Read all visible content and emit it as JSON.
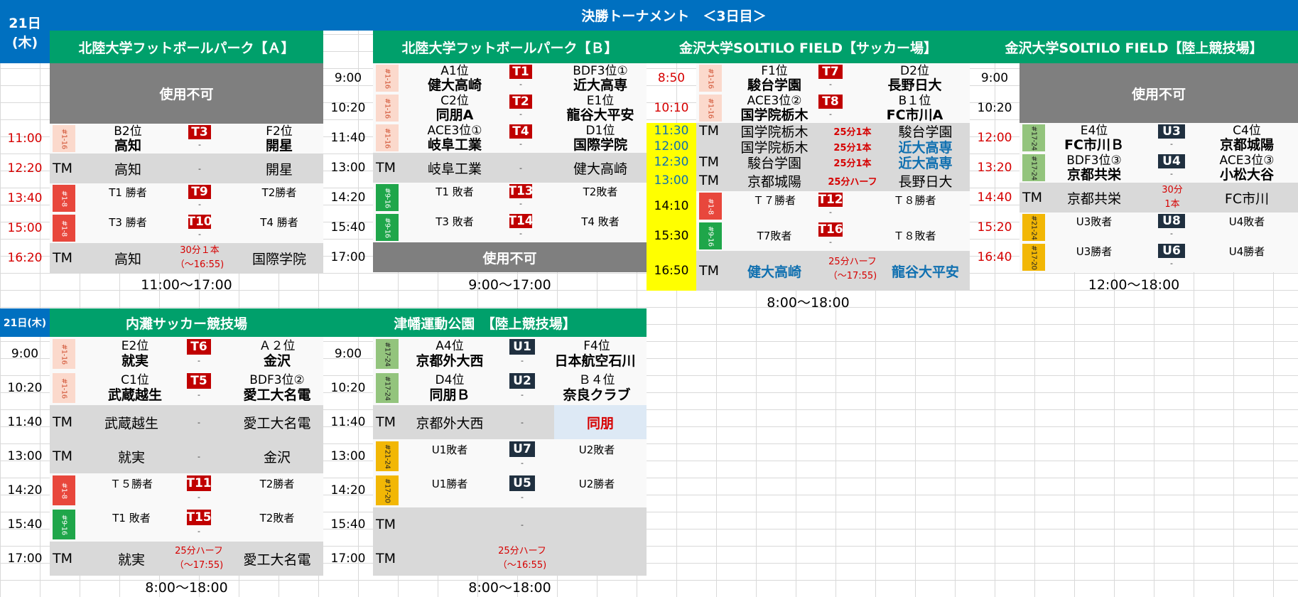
{
  "title": "決勝トーナメント　＜3日目＞",
  "day": "21日",
  "weekday": "(木)",
  "day2": "21日(木)",
  "venues": {
    "a": "北陸大学フットボールパーク【Ａ】",
    "b": "北陸大学フットボールパーク【Ｂ】",
    "c": "金沢大学SOLTILO FIELD【サッカー場】",
    "d": "金沢大学SOLTILO FIELD【陸上競技場】",
    "e": "内灘サッカー競技場",
    "f": "津幡運動公園　【陸上競技場】"
  },
  "unavailable": "使用不可",
  "tm": "TM",
  "dash": "-",
  "hours": {
    "a": "11:00～17:00",
    "b": "9:00～17:00",
    "c": "8:00～18:00",
    "d": "12:00～18:00",
    "e": "8:00～18:00",
    "f": "8:00～18:00"
  },
  "a": {
    "t1": "11:00",
    "m1": {
      "tag": "#1-16",
      "h": "B2位",
      "hs": "高知",
      "b": "T3",
      "a": "F2位",
      "as": "開星"
    },
    "t2": "12:20",
    "r2": {
      "h": "高知",
      "a": "開星"
    },
    "t3": "13:40",
    "m3": {
      "tag": "#1-8",
      "h": "T1 勝者",
      "b": "T9",
      "a": "T2勝者"
    },
    "t4": "15:00",
    "m4": {
      "tag": "#1-8",
      "h": "T3 勝者",
      "b": "T10",
      "a": "T4 勝者"
    },
    "t5": "16:20",
    "r5": {
      "h": "高知",
      "n1": "30分１本",
      "n2": "（～16:55)",
      "a": "国際学院"
    }
  },
  "b": {
    "t1": "9:00",
    "m1": {
      "tag": "#1-16",
      "h": "A1位",
      "hs": "健大高崎",
      "b": "T1",
      "a": "BDF3位①",
      "as": "近大高専"
    },
    "t2": "10:20",
    "m2": {
      "tag": "#1-16",
      "h": "C2位",
      "hs": "同朋A",
      "b": "T2",
      "a": "E1位",
      "as": "龍谷大平安"
    },
    "t3": "11:40",
    "m3": {
      "tag": "#1-16",
      "h": "ACE3位①",
      "hs": "岐阜工業",
      "b": "T4",
      "a": "D1位",
      "as": "国際学院"
    },
    "t4": "13:00",
    "r4": {
      "h": "岐阜工業",
      "a": "健大高崎"
    },
    "t5": "14:20",
    "m5": {
      "tag": "#9-16",
      "h": "T1 敗者",
      "b": "T13",
      "a": "T2敗者"
    },
    "t6": "15:40",
    "m6": {
      "tag": "#9-16",
      "h": "T3 敗者",
      "b": "T14",
      "a": "T4 敗者"
    },
    "t7": "17:00"
  },
  "c": {
    "t1": "8:50",
    "m1": {
      "tag": "#1-16",
      "h": "F1位",
      "hs": "駿台学園",
      "b": "T7",
      "a": "D2位",
      "as": "長野日大"
    },
    "t2": "10:10",
    "m2": {
      "tag": "#1-16",
      "h": "ACE3位②",
      "hs": "国学院栃木",
      "b": "T8",
      "a": "B１位",
      "as": "FC市川A"
    },
    "r": [
      {
        "t": "11:30",
        "tm": "TM",
        "h": "国学院栃木",
        "n": "25分1本",
        "a": "駿台学園",
        "blue": false
      },
      {
        "t": "12:00",
        "tm": "",
        "h": "国学院栃木",
        "n": "25分1本",
        "a": "近大高専",
        "blue": true
      },
      {
        "t": "12:30",
        "tm": "TM",
        "h": "駿台学園",
        "n": "25分1本",
        "a": "近大高専",
        "blue": true
      },
      {
        "t": "13:00",
        "tm": "TM",
        "h": "京都城陽",
        "n": "25分ハーフ",
        "a": "長野日大",
        "blue": false
      }
    ],
    "t7": "14:10",
    "m7": {
      "tag": "#1-8",
      "h": "Ｔ７勝者",
      "b": "T12",
      "a": "Ｔ８勝者"
    },
    "t8": "15:30",
    "m8": {
      "tag": "#9-16",
      "h": "T7敗者",
      "b": "T16",
      "a": "Ｔ８敗者"
    },
    "t9": "16:50",
    "r9": {
      "h": "健大高崎",
      "n1": "25分ハーフ",
      "n2": "（～17:55)",
      "a": "龍谷大平安"
    }
  },
  "d": {
    "t1": "9:00",
    "t2": "10:20",
    "t3": "12:00",
    "m3": {
      "tag": "#17-24",
      "h": "E4位",
      "hs": "FC市川Ｂ",
      "b": "U3",
      "a": "C4位",
      "as": "京都城陽"
    },
    "t4": "13:20",
    "m4": {
      "tag": "#17-24",
      "h": "BDF3位③",
      "hs": "京都共栄",
      "b": "U4",
      "a": "ACE3位③",
      "as": "小松大谷"
    },
    "t5": "14:40",
    "r5": {
      "h": "京都共栄",
      "n1": "30分",
      "n2": "1本",
      "a": "FC市川"
    },
    "t6": "15:20",
    "m6": {
      "tag": "#21-24",
      "h": "U3敗者",
      "b": "U8",
      "a": "U4敗者"
    },
    "t7": "16:40",
    "m7": {
      "tag": "#17-20",
      "h": "U3勝者",
      "b": "U6",
      "a": "U4勝者"
    }
  },
  "e": {
    "t1": "9:00",
    "m1": {
      "tag": "#1-16",
      "h": "E2位",
      "hs": "就実",
      "b": "T6",
      "a": "Ａ２位",
      "as": "金沢"
    },
    "t2": "10:20",
    "m2": {
      "tag": "#1-16",
      "h": "C1位",
      "hs": "武蔵越生",
      "b": "T5",
      "a": "BDF3位②",
      "as": "愛工大名電"
    },
    "t3": "11:40",
    "r3": {
      "h": "武蔵越生",
      "a": "愛工大名電"
    },
    "t4": "13:00",
    "r4": {
      "h": "就実",
      "a": "金沢"
    },
    "t5": "14:20",
    "m5": {
      "tag": "#1-8",
      "h": "Ｔ５勝者",
      "b": "T11",
      "a": "T2勝者"
    },
    "t6": "15:40",
    "m6": {
      "tag": "#9-16",
      "h": "T1 敗者",
      "b": "T15",
      "a": "T2敗者"
    },
    "t7": "17:00",
    "r7": {
      "h": "就実",
      "n1": "25分ハーフ",
      "n2": "（～17:55)",
      "a": "愛工大名電"
    }
  },
  "f": {
    "t1": "9:00",
    "m1": {
      "tag": "#17-24",
      "h": "A4位",
      "hs": "京都外大西",
      "b": "U1",
      "a": "F4位",
      "as": "日本航空石川"
    },
    "t2": "10:20",
    "m2": {
      "tag": "#17-24",
      "h": "D4位",
      "hs": "同朋Ｂ",
      "b": "U2",
      "a": "Ｂ４位",
      "as": "奈良クラブ"
    },
    "t3": "11:40",
    "r3": {
      "h": "京都外大西",
      "a": "同朋"
    },
    "t4": "13:00",
    "m4": {
      "tag": "#21-24",
      "h": "U1敗者",
      "b": "U7",
      "a": "U2敗者"
    },
    "t5": "14:20",
    "m5": {
      "tag": "#17-20",
      "h": "U1勝者",
      "b": "U5",
      "a": "U2勝者"
    },
    "t6": "15:40",
    "t7": "17:00",
    "r7": {
      "n1": "25分ハーフ",
      "n2": "（～16:55)"
    }
  },
  "colors": {
    "header": "#0070c0",
    "venue": "#00a06b",
    "badge_t": "#c00000",
    "badge_u": "#203040",
    "time_red": "#d60000"
  }
}
